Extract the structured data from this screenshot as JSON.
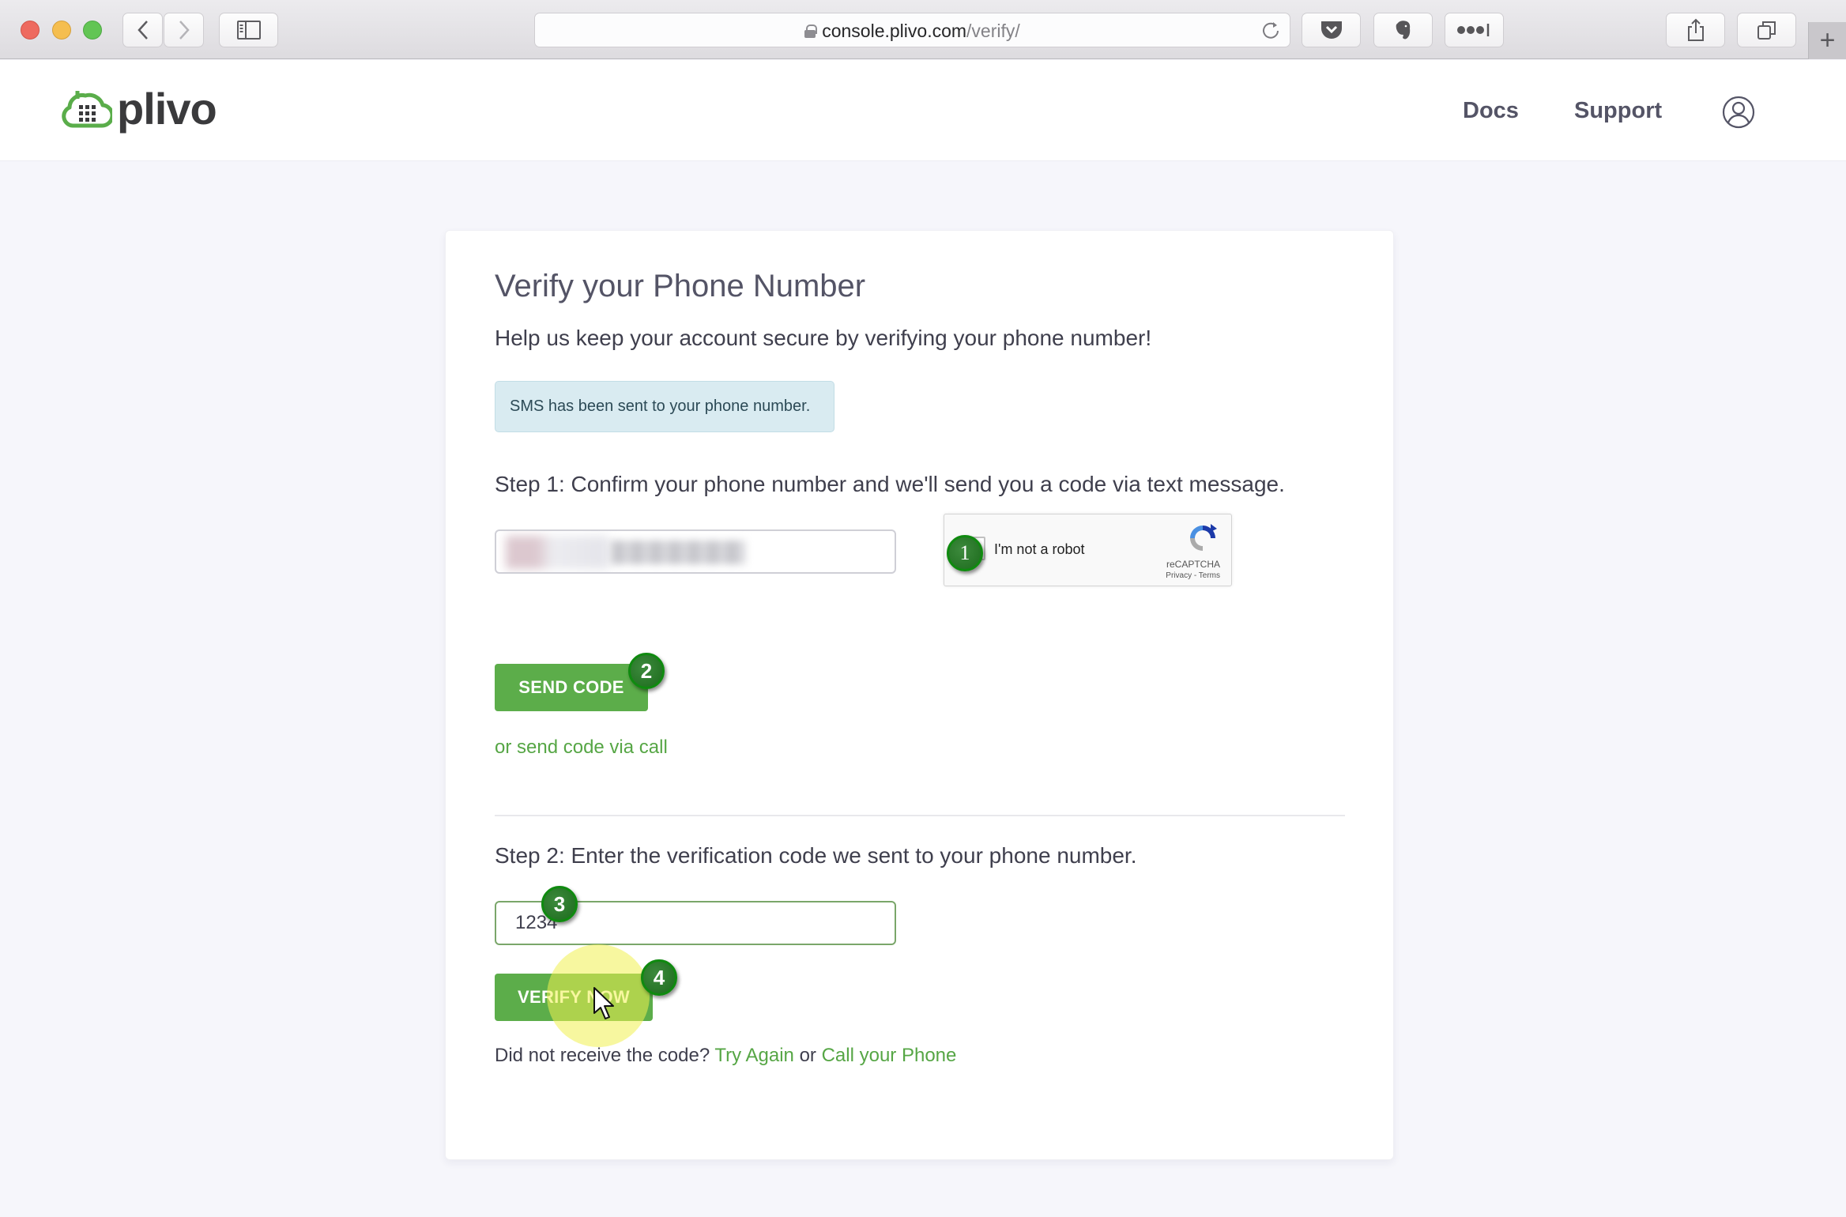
{
  "browser": {
    "url_domain": "console.plivo.com",
    "url_path": "/verify/",
    "icons": [
      "back-icon",
      "forward-icon",
      "sidebar-icon",
      "reload-icon",
      "pocket-icon",
      "evernote-icon",
      "password-manager-icon",
      "share-icon",
      "tabs-icon",
      "new-tab-icon"
    ],
    "new_tab_label": "+"
  },
  "header": {
    "logo_text": "plivo",
    "nav": [
      {
        "label": "Docs"
      },
      {
        "label": "Support"
      }
    ],
    "account_icon": "user-circle-icon"
  },
  "card": {
    "title": "Verify your Phone Number",
    "subtitle": "Help us keep your account secure by verifying your phone number!",
    "alert": "SMS has been sent to your phone number.",
    "step1": {
      "label": "Step 1: Confirm your phone number and we'll send you a code via text message.",
      "phone_value": "",
      "recaptcha": {
        "label": "I'm not a robot",
        "brand": "reCAPTCHA",
        "terms": "Privacy - Terms"
      },
      "send_button": "SEND CODE",
      "alt_link": "or send code via call"
    },
    "step2": {
      "label": "Step 2: Enter the verification code we sent to your phone number.",
      "code_value": "1234",
      "verify_button": "VERIFY NOW",
      "resend_prefix": "Did not receive the code?",
      "try_again": "Try Again",
      "or": "or",
      "call_phone": "Call your Phone"
    }
  },
  "annotations": [
    "1",
    "2",
    "3",
    "4"
  ],
  "colors": {
    "brand_green": "#5cad4a",
    "link_green": "#56a645",
    "alert_bg": "#d9ebf1",
    "page_bg": "#f6f6fb"
  }
}
